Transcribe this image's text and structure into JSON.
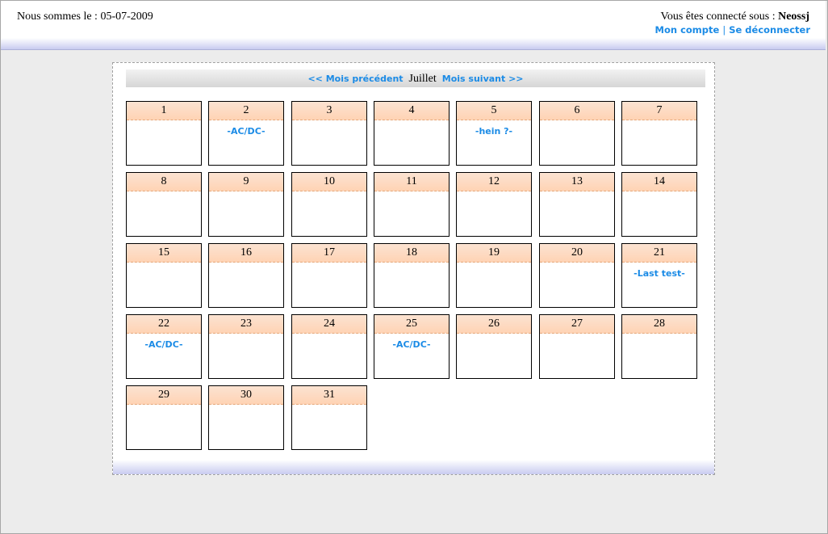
{
  "header": {
    "date_text": "Nous sommes le : 05-07-2009",
    "logged_prefix": "Vous êtes connecté sous : ",
    "username": "Neossj",
    "my_account": "Mon compte",
    "separator": "|",
    "logout": "Se déconnecter"
  },
  "calendar": {
    "prev_label": "<< Mois précédent",
    "month": "Juillet",
    "next_label": "Mois suivant >>",
    "days": [
      {
        "num": "1",
        "event": ""
      },
      {
        "num": "2",
        "event": "-AC/DC-"
      },
      {
        "num": "3",
        "event": ""
      },
      {
        "num": "4",
        "event": ""
      },
      {
        "num": "5",
        "event": "-hein ?-"
      },
      {
        "num": "6",
        "event": ""
      },
      {
        "num": "7",
        "event": ""
      },
      {
        "num": "8",
        "event": ""
      },
      {
        "num": "9",
        "event": ""
      },
      {
        "num": "10",
        "event": ""
      },
      {
        "num": "11",
        "event": ""
      },
      {
        "num": "12",
        "event": ""
      },
      {
        "num": "13",
        "event": ""
      },
      {
        "num": "14",
        "event": ""
      },
      {
        "num": "15",
        "event": ""
      },
      {
        "num": "16",
        "event": ""
      },
      {
        "num": "17",
        "event": ""
      },
      {
        "num": "18",
        "event": ""
      },
      {
        "num": "19",
        "event": ""
      },
      {
        "num": "20",
        "event": ""
      },
      {
        "num": "21",
        "event": "-Last test-"
      },
      {
        "num": "22",
        "event": "-AC/DC-"
      },
      {
        "num": "23",
        "event": ""
      },
      {
        "num": "24",
        "event": ""
      },
      {
        "num": "25",
        "event": "-AC/DC-"
      },
      {
        "num": "26",
        "event": ""
      },
      {
        "num": "27",
        "event": ""
      },
      {
        "num": "28",
        "event": ""
      },
      {
        "num": "29",
        "event": ""
      },
      {
        "num": "30",
        "event": ""
      },
      {
        "num": "31",
        "event": ""
      }
    ]
  }
}
